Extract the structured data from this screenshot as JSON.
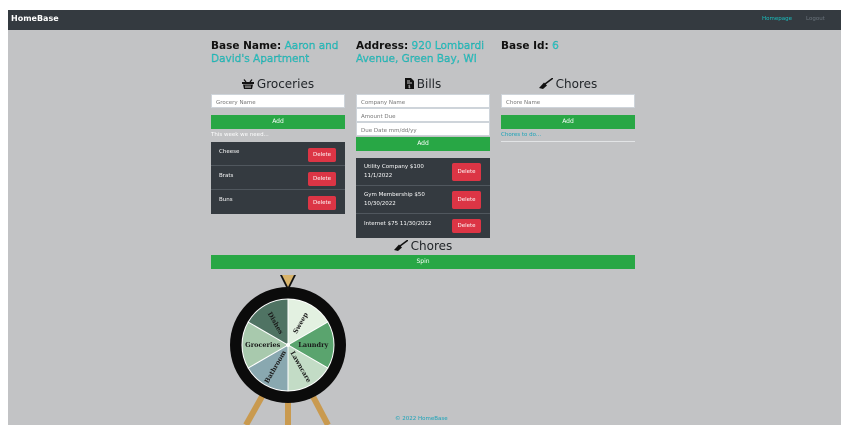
{
  "nav": {
    "brand": "HomeBase",
    "homepage": "Homepage",
    "logout": "Logout"
  },
  "header": {
    "base_name_label": "Base Name:",
    "base_name_value": "Aaron and David's Apartment",
    "address_label": "Address:",
    "address_value": "920 Lombardi Avenue, Green Bay, WI",
    "base_id_label": "Base Id:",
    "base_id_value": "6"
  },
  "groceries": {
    "title": "Groceries",
    "placeholder": "Grocery Name",
    "add_label": "Add",
    "subtitle": "This week we need...",
    "items": [
      "Cheese",
      "Brats",
      "Buns"
    ],
    "delete_label": "Delete"
  },
  "bills": {
    "title": "Bills",
    "company_placeholder": "Company Name",
    "amount_placeholder": "Amount Due",
    "date_placeholder": "Due Date mm/dd/yy",
    "add_label": "Add",
    "delete_label": "Delete",
    "items": [
      {
        "line1": "Utility Company $100",
        "line2": "11/1/2022"
      },
      {
        "line1": "Gym Membership $50",
        "line2": "10/30/2022"
      },
      {
        "line1": "Internet $75 11/30/2022",
        "line2": ""
      }
    ]
  },
  "chores": {
    "title": "Chores",
    "placeholder": "Chore Name",
    "add_label": "Add",
    "subtitle": "Chores to do..."
  },
  "wheel": {
    "title": "Chores",
    "spin_label": "Spin",
    "segments": [
      "Sweep",
      "Laundry",
      "Lawncare",
      "Bathroom",
      "Groceries",
      "Dishes"
    ],
    "colors": [
      "#e3f1e1",
      "#5aa46e",
      "#c3dcc6",
      "#89a8b0",
      "#a8c9ad",
      "#4f7363"
    ]
  },
  "footer": {
    "text": "© 2022 HomeBase"
  }
}
